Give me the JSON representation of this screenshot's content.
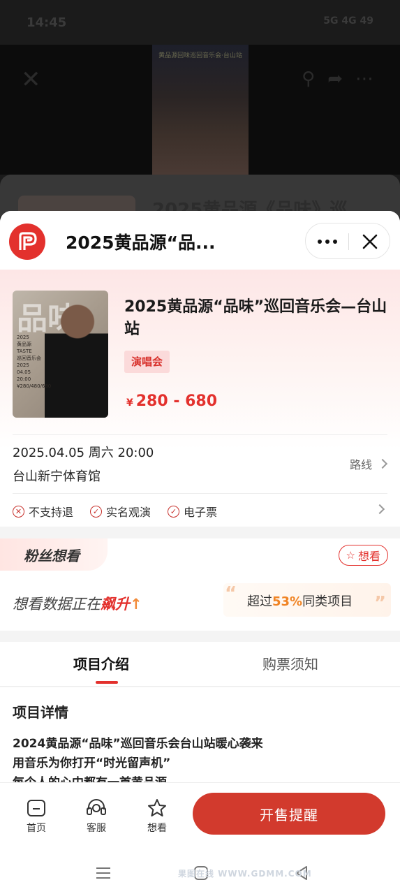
{
  "status": {
    "time": "14:45",
    "indicators": "5G 4G 49"
  },
  "background": {
    "poster_title": "黄品源回味巡回音乐会·台山站",
    "card_title": "2025黄品源《品味》巡"
  },
  "header": {
    "title": "2025黄品源“品..."
  },
  "event": {
    "title": "2025黄品源“品味”巡回音乐会—台山站",
    "tag": "演唱会",
    "price_currency": "¥",
    "price_range": "280 - 680",
    "datetime": "2025.04.05 周六 20:00",
    "venue": "台山新宁体育馆",
    "route_label": "路线",
    "poster": {
      "big_char": "品味",
      "lines": [
        "2025",
        "黄品源",
        "TASTE",
        "巡回音乐会",
        "2025",
        "04.05",
        "20:00",
        "¥280/480/680"
      ]
    },
    "features": [
      {
        "icon": "x-circle-icon",
        "label": "不支持退"
      },
      {
        "icon": "check-circle-icon",
        "label": "实名观演"
      },
      {
        "icon": "check-circle-icon",
        "label": "电子票"
      }
    ]
  },
  "fans": {
    "badge": "粉丝想看",
    "want_button": "想看",
    "hot_prefix": "想看数据正在",
    "hot_strong": "飙升",
    "compare_prefix": "超过",
    "compare_percent": "53%",
    "compare_suffix": "同类项目"
  },
  "tabs": [
    {
      "label": "项目介绍",
      "active": true
    },
    {
      "label": "购票须知",
      "active": false
    }
  ],
  "details": {
    "heading": "项目详情",
    "lines": [
      "2024黄品源“品味”巡回音乐会台山站暖心袭来",
      "用音乐为你打开“时光留声机”",
      "每个人的心中都有一首黄品源"
    ]
  },
  "bottom_nav": [
    {
      "icon": "home-icon",
      "label": "首页"
    },
    {
      "icon": "headset-icon",
      "label": "客服"
    },
    {
      "icon": "star-icon",
      "label": "想看"
    }
  ],
  "cta": {
    "label": "开售提醒"
  },
  "watermark": "果图在线 WWW.GDMM.COM",
  "colors": {
    "accent": "#e3312d",
    "cta": "#d23a2d",
    "orange": "#f08424"
  }
}
